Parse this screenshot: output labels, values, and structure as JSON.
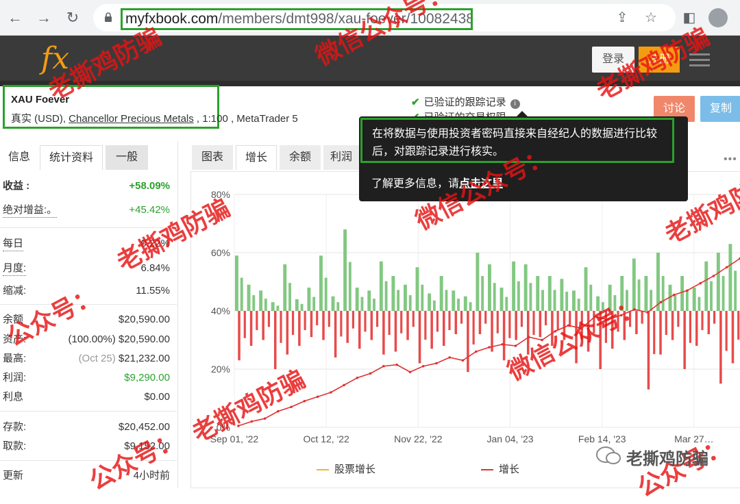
{
  "browser": {
    "url_host": "myfxbook.com",
    "url_path": "/members/dmt998/xau-foever/10082438"
  },
  "site": {
    "logo": "fx",
    "login_label": "登录",
    "register_label": "注册"
  },
  "account": {
    "name": "XAU Foever",
    "type_prefix": "真实 (USD), ",
    "broker": "Chancellor Precious Metals",
    "leverage_platform": " , 1:100 , MetaTrader 5"
  },
  "verification": {
    "track_record": "已验证的跟踪记录",
    "trading_privileges": "已验证的交易权限"
  },
  "actions": {
    "discuss_label": "讨论",
    "copy_label": "复制"
  },
  "tooltip": {
    "text": "在将数据与使用投资者密码直接来自经纪人的数据进行比较后，对跟踪记录进行核实。",
    "more_prefix": "了解更多信息，请",
    "more_link": "点击这里"
  },
  "left_tabs": [
    "信息",
    "统计资料",
    "一般"
  ],
  "stats": {
    "gain_label": "收益 :",
    "gain_value": "+58.09%",
    "abs_gain_label": "绝对增益:。",
    "abs_gain_value": "+45.42%",
    "daily_label": "每日",
    "daily_value": "0.22%",
    "monthly_label": "月度:",
    "monthly_value": "6.84%",
    "drawdown_label": "缩减:",
    "drawdown_value": "11.55%",
    "balance_label": "余额",
    "balance_value": "$20,590.00",
    "equity_label": "资产:",
    "equity_value": "(100.00%) $20,590.00",
    "high_label": "最高:",
    "high_date": "(Oct 25)",
    "high_value": "$21,232.00",
    "profit_label": "利润:",
    "profit_value": "$9,290.00",
    "interest_label": "利息",
    "interest_value": "$0.00",
    "deposits_label": "存款:",
    "deposits_value": "$20,452.00",
    "withdrawals_label": "取款:",
    "withdrawals_value": "$9,152.00",
    "updated_label": "更新",
    "updated_value": "4小时前"
  },
  "chart_tabs": [
    "图表",
    "增长",
    "余额",
    "利润"
  ],
  "chart_data": {
    "type": "line",
    "y_tick_labels": [
      "0%",
      "20%",
      "40%",
      "60%",
      "80%"
    ],
    "ylim": [
      0,
      80
    ],
    "x_tick_labels": [
      "Sep 01, '22",
      "Oct 12, '22",
      "Nov 22, '22",
      "Jan 04, '23",
      "Feb 14, '23",
      "Mar 27…"
    ],
    "grid": true,
    "legend_position": "bottom",
    "series": [
      {
        "name": "股票增长",
        "color": "#f0b429",
        "values": []
      },
      {
        "name": "增长",
        "color": "#e03131",
        "values": [
          0.5,
          2.0,
          3.0,
          5.5,
          7.0,
          9.0,
          10.5,
          12.0,
          14.5,
          17.0,
          18.5,
          21.0,
          21.5,
          19.0,
          21.0,
          22.0,
          24.0,
          23.0,
          26.0,
          27.5,
          28.5,
          28.0,
          31.0,
          30.0,
          33.0,
          35.0,
          34.0,
          38.0,
          37.0,
          38.5,
          40.5,
          39.5,
          43.0,
          45.5,
          47.0,
          49.5,
          52.0,
          55.0,
          58.0
        ]
      },
      {
        "name": "",
        "type": "bar",
        "color": "#82c882",
        "values": [
          19,
          9,
          7,
          3,
          16,
          4,
          8,
          19,
          5,
          28,
          8,
          7,
          17,
          12,
          9,
          15,
          6,
          12,
          7,
          5,
          20,
          16,
          8,
          17,
          16,
          12,
          12,
          11,
          7,
          15,
          5,
          9,
          12,
          18,
          12,
          20,
          9,
          12,
          8,
          17,
          20,
          23
        ]
      },
      {
        "name": "",
        "type": "bar",
        "color": "#e84a4a",
        "values": [
          -17,
          -12,
          -10,
          -20,
          -15,
          -12,
          -9,
          -10,
          -16,
          -11,
          -13,
          -10,
          -15,
          -14,
          -10,
          -18,
          -13,
          -12,
          -8,
          -21,
          -8,
          -14,
          -17,
          -10,
          -15,
          -9,
          -12,
          -10,
          -18,
          -14,
          -20,
          -13,
          -10,
          -8,
          -27,
          -15,
          -10,
          -20,
          -12,
          -8,
          -25,
          -18
        ]
      }
    ]
  },
  "watermark": {
    "a": "老撕鸡防骗",
    "b": "微信公众号：",
    "c": "公众号："
  },
  "wechat_tag": "老撕鸡防骗"
}
